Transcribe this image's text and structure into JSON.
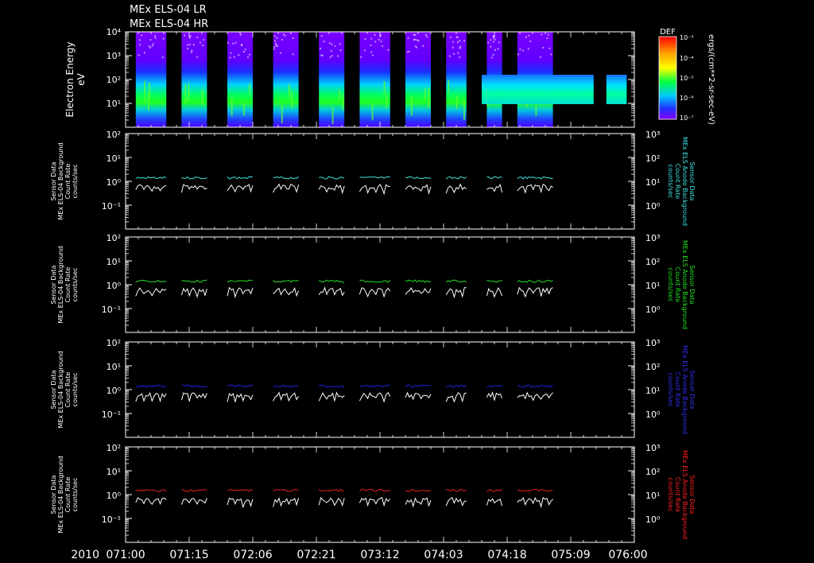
{
  "title_lines": [
    "MEx ELS-04 LR",
    "MEx ELS-04 HR"
  ],
  "colorbar": {
    "label": "DEF",
    "tick_labels": [
      "10⁻³",
      "10⁻⁴",
      "10⁻⁵",
      "10⁻⁶",
      "10⁻⁷"
    ],
    "units": "ergs/(cm**2-sr-sec-eV)"
  },
  "x_axis": {
    "year_label": "2010",
    "tick_labels": [
      "071:00",
      "071:15",
      "072:06",
      "072:21",
      "073:12",
      "074:03",
      "074:18",
      "075:09",
      "076:00"
    ]
  },
  "chart_data": [
    {
      "type": "heatmap",
      "panel": "spectrogram",
      "ylabel_lines": [
        "Electron Energy",
        "eV"
      ],
      "y_scale": "log",
      "ylim": [
        1,
        10000
      ],
      "y_tick_labels": [
        "10⁴",
        "10³",
        "10²",
        "10¹"
      ],
      "colorscale": "rainbow",
      "lr_bursts_x": [
        [
          0.02,
          0.08
        ],
        [
          0.11,
          0.16
        ],
        [
          0.2,
          0.25
        ],
        [
          0.29,
          0.34
        ],
        [
          0.38,
          0.43
        ],
        [
          0.46,
          0.52
        ],
        [
          0.55,
          0.6
        ],
        [
          0.63,
          0.67
        ],
        [
          0.71,
          0.74
        ],
        [
          0.77,
          0.84
        ]
      ],
      "hr_segments_x": [
        [
          0.7,
          0.92
        ],
        [
          0.945,
          0.985
        ]
      ]
    },
    {
      "type": "line",
      "panel": "background-1",
      "ylabel_lines": [
        "Sensor Data",
        "MEx ELS-04 Background",
        "Count Rate",
        "counts/sec"
      ],
      "y_scale": "log",
      "ylim": [
        0.01,
        100
      ],
      "y_tick_labels": [
        "10²",
        "10¹",
        "10⁰",
        "10⁻¹"
      ],
      "y2lim": [
        0.1,
        1000
      ],
      "y2_tick_labels": [
        "10³",
        "10²",
        "10¹",
        "10⁰"
      ],
      "y2label_lines": [
        "Sensor Data",
        "MEx ELS Anode Background",
        "Count Rate",
        "counts/sec"
      ],
      "color": "#40e0e0",
      "series": [
        {
          "label": "white",
          "level": 0.6
        },
        {
          "label": "colored",
          "level": 1.4
        }
      ]
    },
    {
      "type": "line",
      "panel": "background-2",
      "ylabel_lines": [
        "Sensor Data",
        "MEx ELS-04 Background",
        "Count Rate",
        "counts/sec"
      ],
      "y_scale": "log",
      "ylim": [
        0.01,
        100
      ],
      "y_tick_labels": [
        "10²",
        "10¹",
        "10⁰",
        "10⁻¹"
      ],
      "y2lim": [
        0.1,
        1000
      ],
      "y2_tick_labels": [
        "10³",
        "10²",
        "10¹",
        "10⁰"
      ],
      "y2label_lines": [
        "Sensor Data",
        "MEx ELS Anode Background",
        "Count Rate",
        "counts/sec"
      ],
      "color": "#20e020",
      "series": [
        {
          "label": "white",
          "level": 0.6
        },
        {
          "label": "colored",
          "level": 1.4
        }
      ]
    },
    {
      "type": "line",
      "panel": "background-3",
      "ylabel_lines": [
        "Sensor Data",
        "MEx ELS-04 Background",
        "Count Rate",
        "counts/sec"
      ],
      "y_scale": "log",
      "ylim": [
        0.01,
        100
      ],
      "y_tick_labels": [
        "10²",
        "10¹",
        "10⁰",
        "10⁻¹"
      ],
      "y2lim": [
        0.1,
        1000
      ],
      "y2_tick_labels": [
        "10³",
        "10²",
        "10¹",
        "10⁰"
      ],
      "y2label_lines": [
        "Sensor Data",
        "MEx ELS Anode Background",
        "Count Rate",
        "counts/sec"
      ],
      "color": "#2020e0",
      "series": [
        {
          "label": "white",
          "level": 0.6
        },
        {
          "label": "colored",
          "level": 1.4
        }
      ]
    },
    {
      "type": "line",
      "panel": "background-4",
      "ylabel_lines": [
        "Sensor Data",
        "MEx ELS-04 Background",
        "Count Rate",
        "counts/sec"
      ],
      "y_scale": "log",
      "ylim": [
        0.01,
        100
      ],
      "y_tick_labels": [
        "10²",
        "10¹",
        "10⁰",
        "10⁻¹"
      ],
      "y2lim": [
        0.1,
        1000
      ],
      "y2_tick_labels": [
        "10³",
        "10²",
        "10¹",
        "10⁰"
      ],
      "y2label_lines": [
        "Sensor Data",
        "MEx ELS Anode Background",
        "Count Rate",
        "counts/sec"
      ],
      "color": "#e02020",
      "series": [
        {
          "label": "white",
          "level": 0.6
        },
        {
          "label": "colored",
          "level": 1.5
        }
      ]
    }
  ]
}
